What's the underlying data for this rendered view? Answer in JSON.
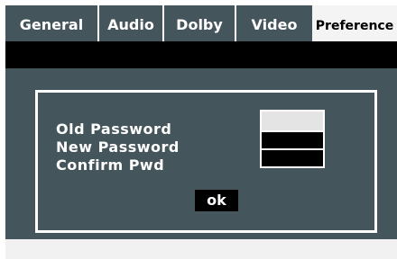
{
  "tabs": [
    {
      "label": "General"
    },
    {
      "label": "Audio"
    },
    {
      "label": "Dolby"
    },
    {
      "label": "Video"
    },
    {
      "label": "Preference"
    }
  ],
  "active_tab": "Preference",
  "dialog": {
    "old_password_label": "Old Password",
    "new_password_label": "New Password",
    "confirm_password_label": "Confirm Pwd",
    "old_password_value": "",
    "new_password_value": "",
    "confirm_password_value": "",
    "ok_label": "ok"
  },
  "colors": {
    "panel": "#45555c",
    "selected_field": "#e4e4e4",
    "field": "#000000",
    "text": "#ffffff",
    "active_tab_bg": "#f4f4f4"
  }
}
